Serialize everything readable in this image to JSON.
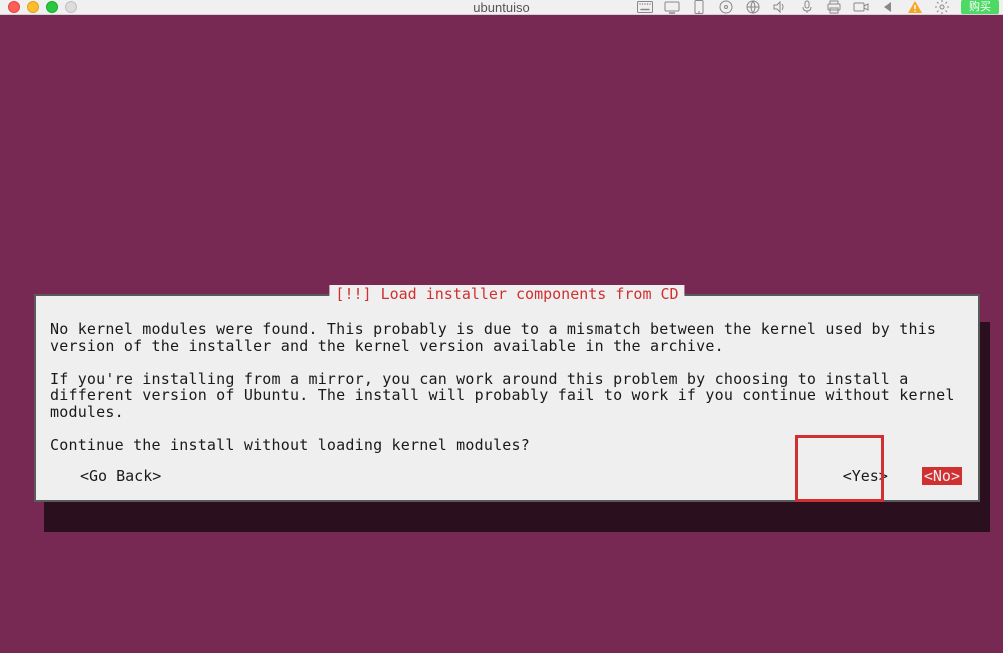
{
  "menubar": {
    "center_title": "ubuntuiso",
    "green_button_label": "购买"
  },
  "dialog": {
    "title": "[!!] Load installer components from CD",
    "paragraph1": "No kernel modules were found. This probably is due to a mismatch between the kernel used by this version of the installer and the kernel version available in the archive.",
    "paragraph2": "If you're installing from a mirror, you can work around this problem by choosing to install a different version of Ubuntu. The install will probably fail to work if you continue without kernel modules.",
    "question": "Continue the install without loading kernel modules?",
    "go_back_label": "<Go Back>",
    "yes_label": "<Yes>",
    "no_label": "<No>"
  }
}
